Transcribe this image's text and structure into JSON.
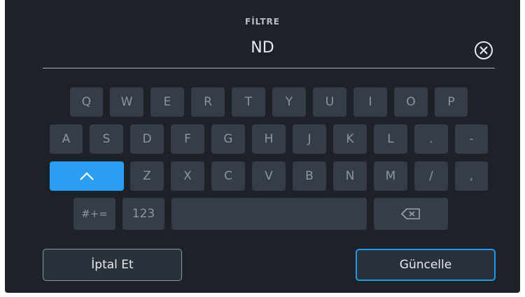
{
  "header": {
    "title": "FİLTRE"
  },
  "input": {
    "value": "ND"
  },
  "keyboard": {
    "row1": [
      "Q",
      "W",
      "E",
      "R",
      "T",
      "Y",
      "U",
      "I",
      "O",
      "P"
    ],
    "row2": [
      "A",
      "S",
      "D",
      "F",
      "G",
      "H",
      "J",
      "K",
      "L",
      ".",
      "-"
    ],
    "row3": [
      "Z",
      "X",
      "C",
      "V",
      "B",
      "N",
      "M",
      "/",
      ","
    ],
    "row4": {
      "symbols": "#+=",
      "numbers": "123"
    }
  },
  "actions": {
    "cancel": "İptal Et",
    "update": "Güncelle"
  },
  "icons": {
    "clear": "clear-circle-icon",
    "shift": "chevron-up-icon",
    "backspace": "backspace-icon"
  },
  "colors": {
    "accent": "#2a9ef0",
    "background": "#1d2229",
    "key": "#363d49"
  }
}
